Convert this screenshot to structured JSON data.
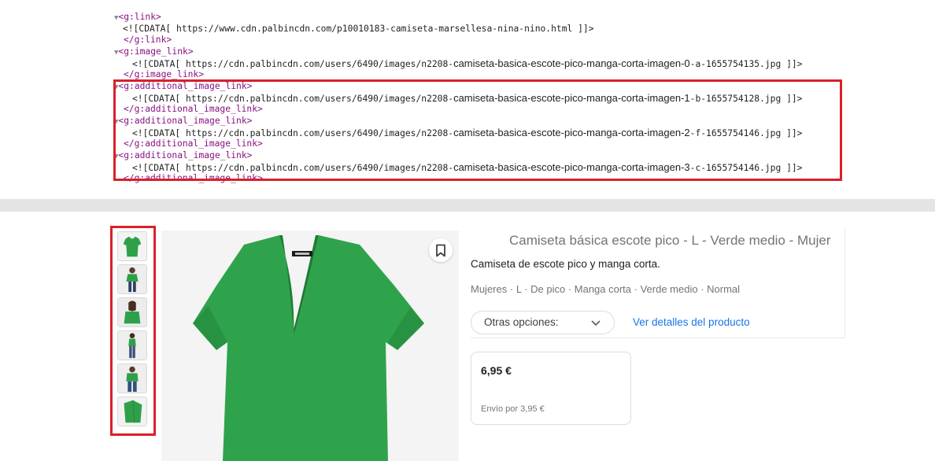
{
  "xml": {
    "lines": [
      {
        "text": "<g:link>",
        "kind": "open"
      },
      {
        "text": "<![CDATA[ https://www.cdn.palbincdn.com/p10010183-camiseta-marsellesa-nina-nino.html ]]>",
        "kind": "cdata"
      },
      {
        "text": "</g:link>",
        "kind": "close"
      },
      {
        "text": "<g:image_link>",
        "kind": "open"
      },
      {
        "text": "<![CDATA[ https://cdn.palbincdn.com/users/6490/images/n2208-",
        "kind": "cdata",
        "prop": "camiseta-basica-escote-pico-manga-corta-imagen-0",
        "suffix": "-a-1655754135.jpg ]]>"
      },
      {
        "text": "</g:image_link>",
        "kind": "close"
      },
      {
        "text": "<g:additional_image_link>",
        "kind": "open"
      },
      {
        "text": "<![CDATA[ https://cdn.palbincdn.com/users/6490/images/n2208-",
        "kind": "cdata",
        "prop": "camiseta-basica-escote-pico-manga-corta-imagen-1",
        "suffix": "-b-1655754128.jpg ]]>"
      },
      {
        "text": "</g:additional_image_link>",
        "kind": "close"
      },
      {
        "text": "<g:additional_image_link>",
        "kind": "open"
      },
      {
        "text": "<![CDATA[ https://cdn.palbincdn.com/users/6490/images/n2208-",
        "kind": "cdata",
        "prop": "camiseta-basica-escote-pico-manga-corta-imagen-2",
        "suffix": "-f-1655754146.jpg ]]>"
      },
      {
        "text": "</g:additional_image_link>",
        "kind": "close"
      },
      {
        "text": "<g:additional_image_link>",
        "kind": "open"
      },
      {
        "text": "<![CDATA[ https://cdn.palbincdn.com/users/6490/images/n2208-",
        "kind": "cdata",
        "prop": "camiseta-basica-escote-pico-manga-corta-imagen-3",
        "suffix": "-c-1655754146.jpg ]]>"
      },
      {
        "text": "</g:additional_image_link>",
        "kind": "close"
      }
    ]
  },
  "product": {
    "title": "Camiseta básica escote pico - L - Verde medio - Mujer",
    "description": "Camiseta de escote pico y manga corta.",
    "attributes": [
      "Mujeres",
      "L",
      "De pico",
      "Manga corta",
      "Verde medio",
      "Normal"
    ],
    "options_label": "Otras opciones:",
    "details_link": "Ver detalles del producto",
    "price": "6,95 €",
    "shipping": "Envío por 3,95 €",
    "thumbnails": [
      "front",
      "model-front",
      "model-back-hair",
      "model-side",
      "model-front-jeans",
      "folded"
    ]
  },
  "colors": {
    "highlight": "#d9202b",
    "link": "#1a73e8",
    "tag": "#881280",
    "shirt": "#2ea04a"
  },
  "icons": {
    "bookmark": "bookmark-icon",
    "chevron": "chevron-down-icon",
    "expand": "triangle-down-icon"
  }
}
